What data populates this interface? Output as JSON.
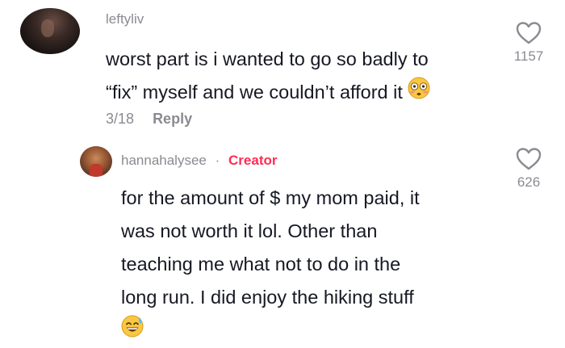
{
  "comment_1": {
    "username": "leftyliv",
    "line_1": "worst part is i wanted to go so badly to",
    "line_2": "“fix” myself and we couldn’t afford it",
    "emoji": "flushed-face-emoji",
    "date": "3/18",
    "reply_label": "Reply",
    "like_count": "1157"
  },
  "comment_2": {
    "username": "hannahalysee",
    "separator": "·",
    "badge": "Creator",
    "line_1": "for the amount of $ my mom paid, it",
    "line_2": "was not worth it lol. Other than",
    "line_3": "teaching me what not to do in the",
    "line_4": "long run. I did enjoy the hiking stuff",
    "emoji": "grinning-face-with-sweat-emoji",
    "like_count": "626"
  },
  "colors": {
    "text": "#161823",
    "muted": "#8a8b91",
    "creator": "#fe2c55",
    "background": "#ffffff"
  }
}
